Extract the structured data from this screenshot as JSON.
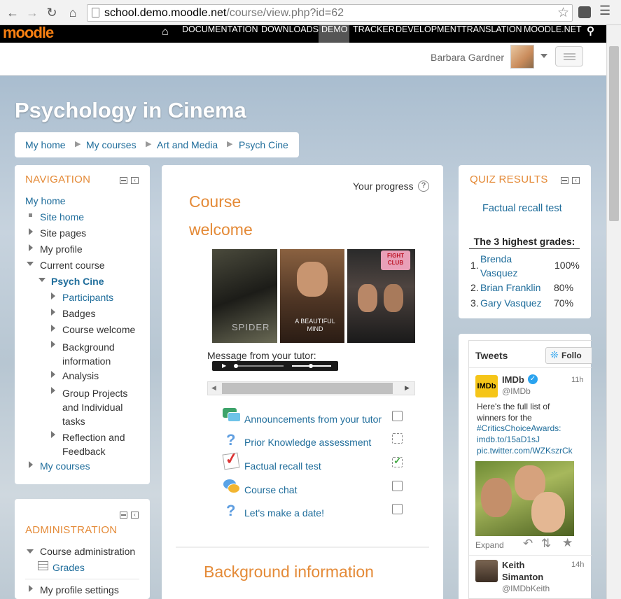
{
  "browser": {
    "url_host": "school.demo.moodle.net",
    "url_path": "/course/view.php?id=62"
  },
  "topbar": {
    "logo": "moodle",
    "nav": [
      "DOCUMENTATION",
      "DOWNLOADS",
      "DEMO",
      "TRACKER",
      "DEVELOPMENT",
      "TRANSLATION",
      "MOODLE.NET"
    ]
  },
  "user": {
    "name": "Barbara Gardner"
  },
  "page": {
    "title": "Psychology in Cinema"
  },
  "breadcrumb": [
    "My home",
    "My courses",
    "Art and Media",
    "Psych Cine"
  ],
  "navigation": {
    "heading": "NAVIGATION",
    "my_home": "My home",
    "site_home": "Site home",
    "site_pages": "Site pages",
    "my_profile": "My profile",
    "current_course": "Current course",
    "course": "Psych Cine",
    "course_items": [
      "Participants",
      "Badges",
      "Course welcome",
      "Background information",
      "Analysis",
      "Group Projects and Individual tasks",
      "Reflection and Feedback"
    ],
    "my_courses": "My courses"
  },
  "administration": {
    "heading": "ADMINISTRATION",
    "course_admin": "Course administration",
    "grades": "Grades",
    "my_profile_settings": "My profile settings"
  },
  "main": {
    "your_progress": "Your progress",
    "section_title": "Course welcome",
    "posters": [
      "SPIDER",
      "A BEAUTIFUL MIND",
      "FIGHT CLUB"
    ],
    "message_label": "Message from your tutor:",
    "activities": [
      {
        "label": "Announcements from your tutor",
        "icon": "forum-icon",
        "done": false
      },
      {
        "label": "Prior Knowledge assessment",
        "icon": "question-icon",
        "done": false
      },
      {
        "label": "Factual recall test",
        "icon": "quiz-icon",
        "done": true
      },
      {
        "label": "Course chat",
        "icon": "chat-icon",
        "done": false
      },
      {
        "label": "Let's make a date!",
        "icon": "question-icon",
        "done": false
      }
    ],
    "next_section": "Background information"
  },
  "quiz_results": {
    "heading": "QUIZ RESULTS",
    "quiz": "Factual recall test",
    "subheading": "The 3 highest grades:",
    "rows": [
      {
        "rank": "1.",
        "name": "Brenda Vasquez",
        "grade": "100%"
      },
      {
        "rank": "2.",
        "name": "Brian Franklin",
        "grade": "80%"
      },
      {
        "rank": "3.",
        "name": "Gary Vasquez",
        "grade": "70%"
      }
    ]
  },
  "tweets": {
    "heading": "Tweets",
    "follow": "Follo",
    "tweet1": {
      "name": "IMDb",
      "handle": "@IMDb",
      "time": "11h",
      "text": "Here's the full list of winners for the",
      "hashtag": "#CriticsChoiceAwards:",
      "link1": "imdb.to/15aD1sJ",
      "link2": "pic.twitter.com/WZKszrCk",
      "expand": "Expand"
    },
    "tweet2": {
      "name_line1": "Keith",
      "name_line2": "Simanton",
      "handle": "@IMDbKeith",
      "time": "14h"
    }
  }
}
